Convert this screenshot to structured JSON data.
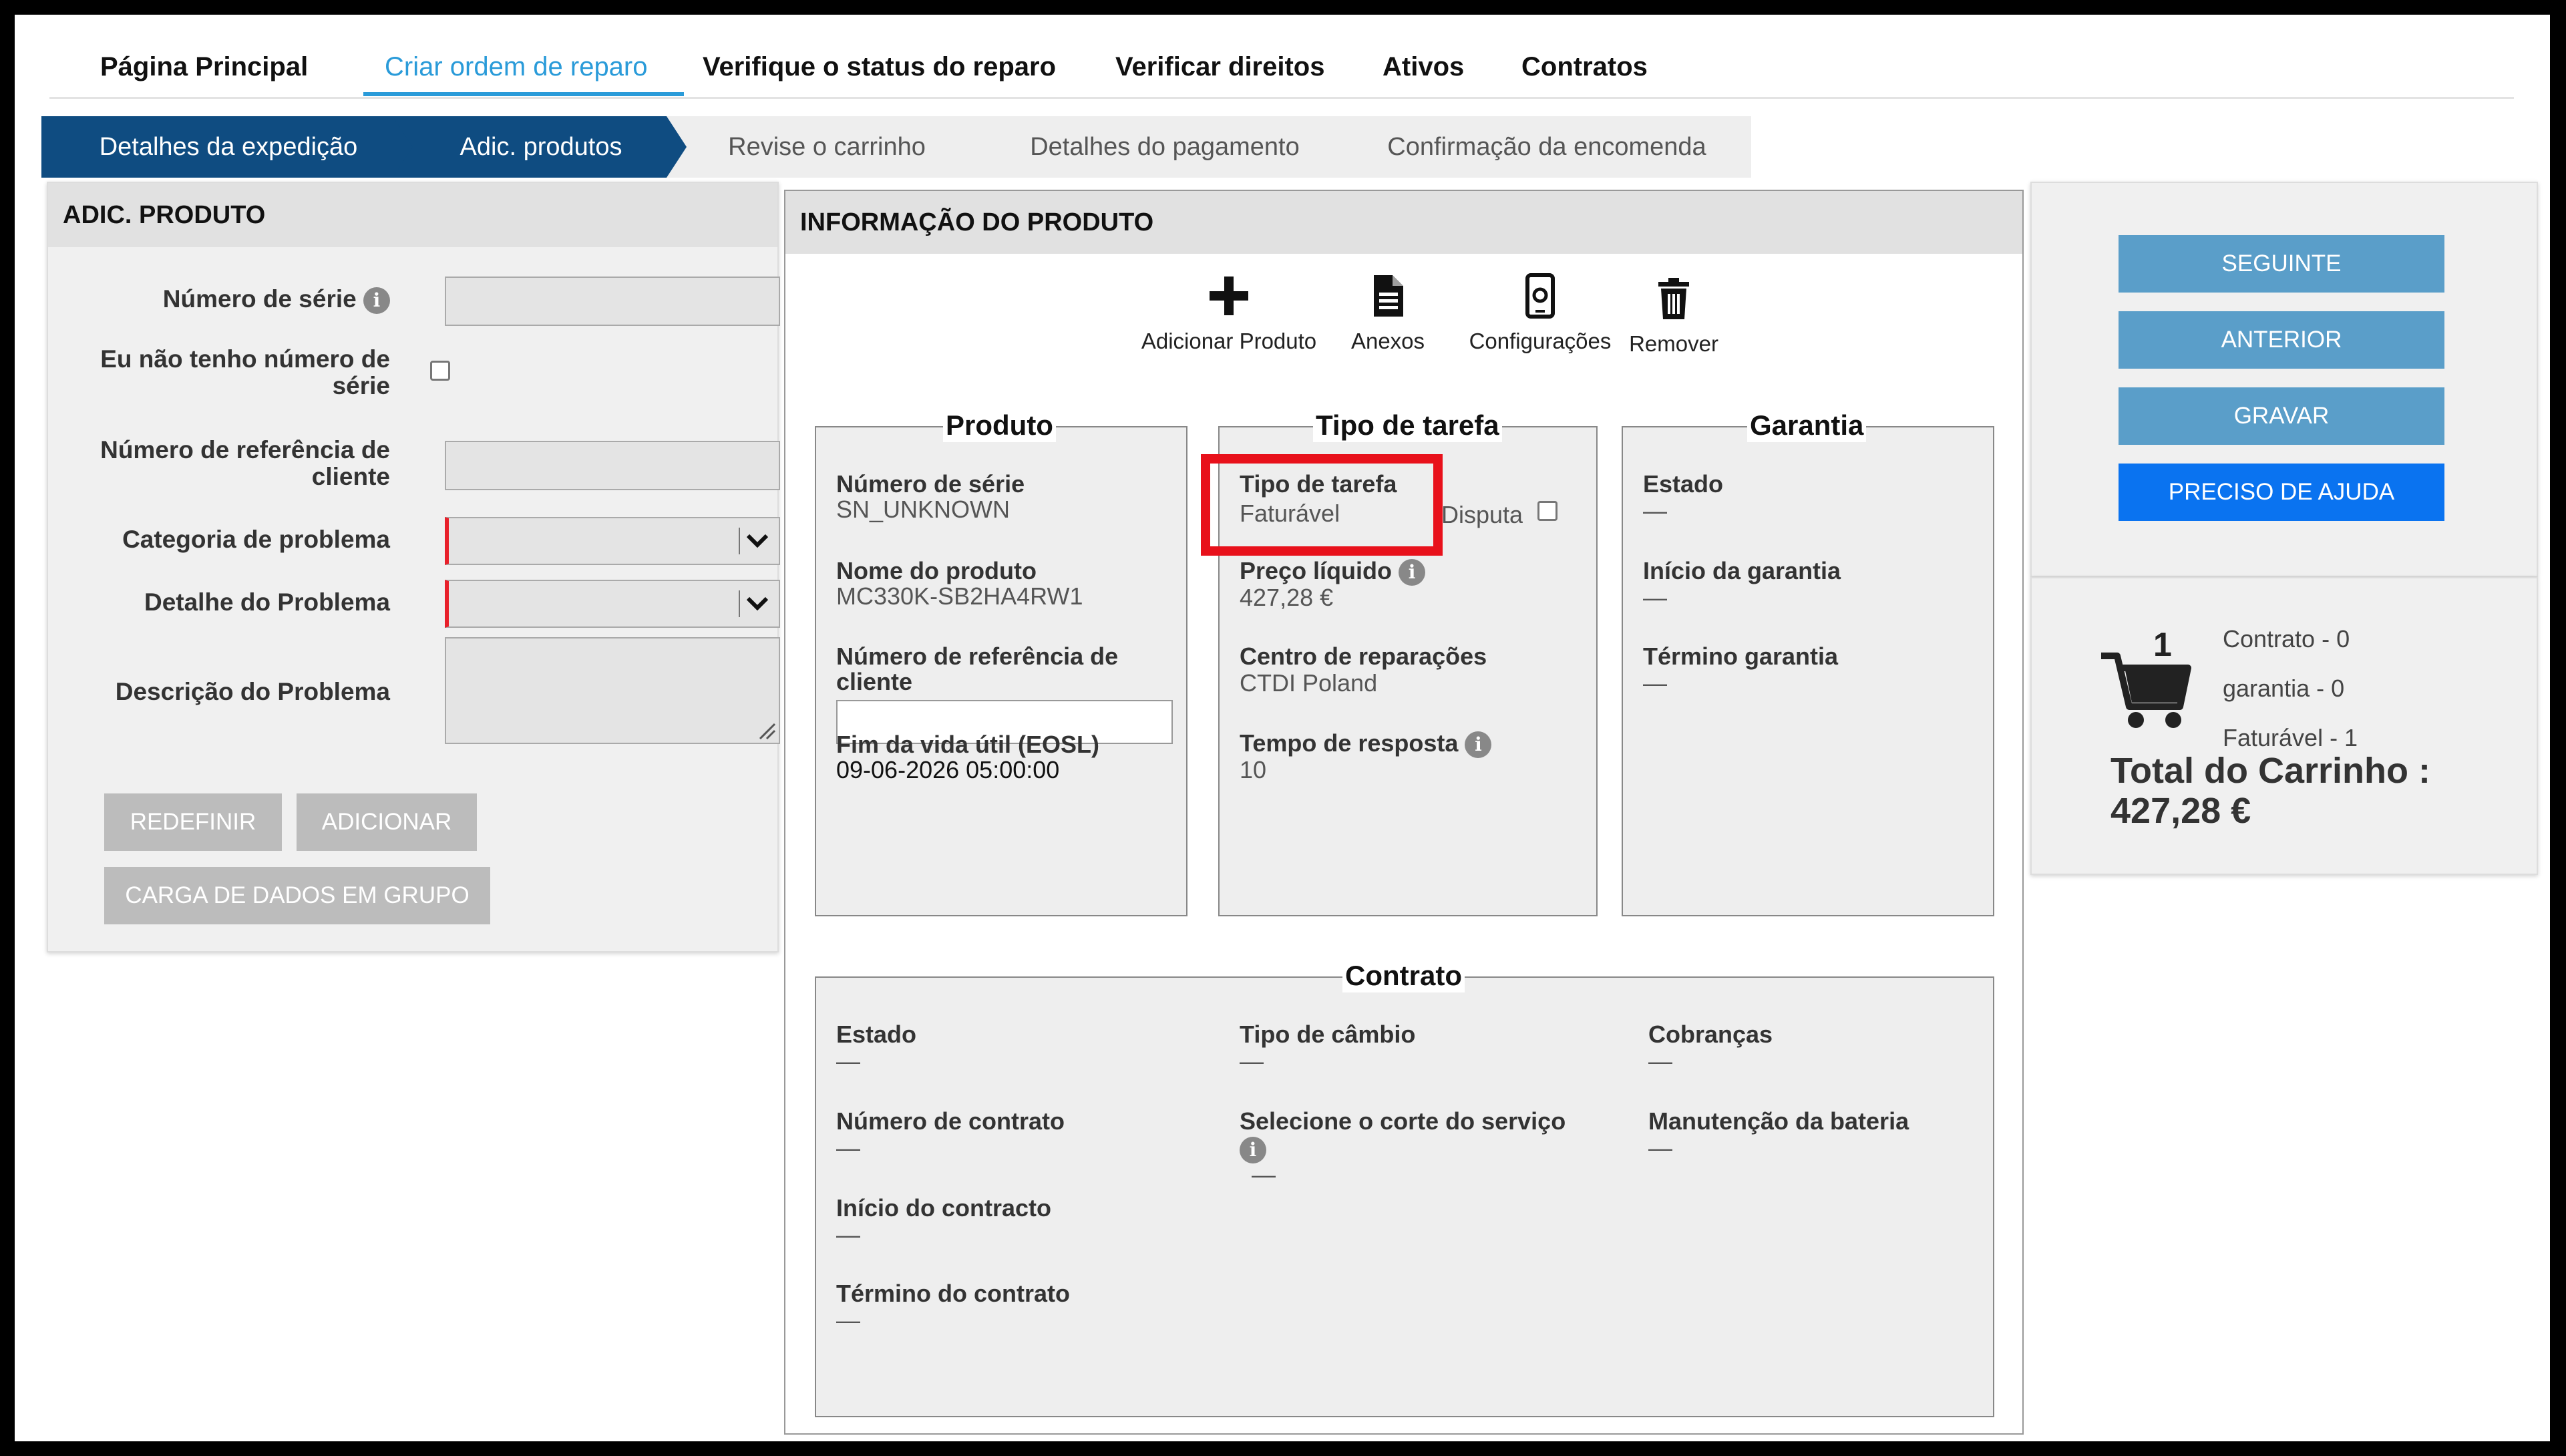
{
  "nav": {
    "items": [
      "Página Principal",
      "Criar ordem de reparo",
      "Verifique o status do reparo",
      "Verificar direitos",
      "Ativos",
      "Contratos"
    ],
    "active_index": 1
  },
  "steps": {
    "items": [
      "Detalhes da expedição",
      "Adic. produtos",
      "Revise o carrinho",
      "Detalhes do pagamento",
      "Confirmação da encomenda"
    ],
    "completed_count": 2
  },
  "add_product": {
    "title": "ADIC. PRODUTO",
    "serial_label": "Número de série",
    "no_serial_label": "Eu não tenho número de série",
    "customer_ref_label": "Número de referência de cliente",
    "problem_category_label": "Categoria de problema",
    "problem_detail_label": "Detalhe do Problema",
    "problem_description_label": "Descrição do Problema",
    "reset_button": "REDEFINIR",
    "add_button": "ADICIONAR",
    "bulk_upload_button": "CARGA DE DADOS EM GRUPO"
  },
  "product_info": {
    "title": "INFORMAÇÃO DO PRODUTO",
    "tools": {
      "add_product": "Adicionar Produto",
      "attachments": "Anexos",
      "configurations": "Configurações",
      "remove": "Remover"
    },
    "product": {
      "title": "Produto",
      "serial_label": "Número de série",
      "serial_value": "SN_UNKNOWN",
      "name_label": "Nome do produto",
      "name_value": "MC330K-SB2HA4RW1",
      "customer_ref_label": "Número de referência de cliente",
      "eosl_label": "Fim da vida útil (EOSL)",
      "eosl_value": "09-06-2026 05:00:00"
    },
    "task_type": {
      "title": "Tipo de tarefa",
      "type_label": "Tipo de tarefa",
      "type_value": "Faturável",
      "dispute_label": "Disputa",
      "net_price_label": "Preço líquido",
      "net_price_value": "427,28 €",
      "repair_center_label": "Centro de reparações",
      "repair_center_value": "CTDI Poland",
      "response_time_label": "Tempo de resposta",
      "response_time_value": "10"
    },
    "warranty": {
      "title": "Garantia",
      "status_label": "Estado",
      "start_label": "Início da garantia",
      "end_label": "Término garantia",
      "empty": "—"
    },
    "contract": {
      "title": "Contrato",
      "status_label": "Estado",
      "exchange_label": "Tipo de câmbio",
      "charges_label": "Cobranças",
      "number_label": "Número de contrato",
      "service_cut_label": "Selecione o corte do serviço",
      "battery_label": "Manutenção da bateria",
      "start_label": "Início do contracto",
      "end_label": "Término do contrato",
      "empty": "—"
    }
  },
  "actions": {
    "next": "SEGUINTE",
    "previous": "ANTERIOR",
    "save": "GRAVAR",
    "help": "PRECISO DE AJUDA"
  },
  "cart": {
    "count": "1",
    "contract_line": "Contrato - 0",
    "warranty_line": "garantia - 0",
    "billable_line": "Faturável - 1",
    "total_label": "Total do Carrinho :",
    "total_value": "427,28 €"
  },
  "colors": {
    "accent": "#2a9bd9",
    "step_done": "#0f4c81",
    "step_pending": "#eeeeee",
    "highlight": "#e8111b",
    "required": "#e8202a",
    "action_button": "#5a9ec9",
    "help_button": "#0a73f0"
  },
  "icons": [
    "info-icon",
    "chevron-down-icon",
    "plus-icon",
    "document-icon",
    "mobile-settings-icon",
    "trash-icon",
    "cart-icon",
    "resize-handle-icon"
  ]
}
